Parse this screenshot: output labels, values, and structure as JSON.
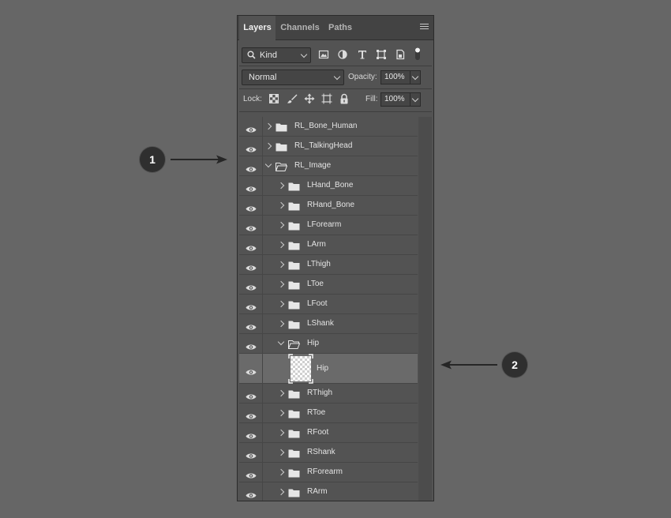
{
  "tabs": [
    {
      "label": "Layers",
      "active": true
    },
    {
      "label": "Channels",
      "active": false
    },
    {
      "label": "Paths",
      "active": false
    }
  ],
  "panel_menu_icon": "hamburger-menu-icon",
  "filter": {
    "kind_label": "Kind",
    "icons": [
      "image-filter-icon",
      "adjustment-filter-icon",
      "type-filter-icon",
      "shape-filter-icon",
      "smart-object-filter-icon",
      "filter-toggle-icon"
    ]
  },
  "blend": {
    "mode": "Normal",
    "opacity_label": "Opacity:",
    "opacity_value": "100%"
  },
  "lock": {
    "label": "Lock:",
    "icons": [
      "lock-transparent-pixels-icon",
      "lock-image-pixels-icon",
      "lock-position-icon",
      "lock-artboard-icon",
      "lock-all-icon"
    ],
    "fill_label": "Fill:",
    "fill_value": "100%"
  },
  "layers": [
    {
      "name": "RL_Bone_Human",
      "level": 0,
      "type": "group",
      "expanded": false
    },
    {
      "name": "RL_TalkingHead",
      "level": 0,
      "type": "group",
      "expanded": false
    },
    {
      "name": "RL_Image",
      "level": 0,
      "type": "group",
      "expanded": true
    },
    {
      "name": "LHand_Bone",
      "level": 1,
      "type": "group",
      "expanded": false
    },
    {
      "name": "RHand_Bone",
      "level": 1,
      "type": "group",
      "expanded": false
    },
    {
      "name": "LForearm",
      "level": 1,
      "type": "group",
      "expanded": false
    },
    {
      "name": "LArm",
      "level": 1,
      "type": "group",
      "expanded": false
    },
    {
      "name": "LThigh",
      "level": 1,
      "type": "group",
      "expanded": false
    },
    {
      "name": "LToe",
      "level": 1,
      "type": "group",
      "expanded": false
    },
    {
      "name": "LFoot",
      "level": 1,
      "type": "group",
      "expanded": false
    },
    {
      "name": "LShank",
      "level": 1,
      "type": "group",
      "expanded": false
    },
    {
      "name": "Hip",
      "level": 1,
      "type": "group",
      "expanded": true
    },
    {
      "name": "Hip",
      "level": 2,
      "type": "layer",
      "selected": true
    },
    {
      "name": "RThigh",
      "level": 1,
      "type": "group",
      "expanded": false
    },
    {
      "name": "RToe",
      "level": 1,
      "type": "group",
      "expanded": false
    },
    {
      "name": "RFoot",
      "level": 1,
      "type": "group",
      "expanded": false
    },
    {
      "name": "RShank",
      "level": 1,
      "type": "group",
      "expanded": false
    },
    {
      "name": "RForearm",
      "level": 1,
      "type": "group",
      "expanded": false
    },
    {
      "name": "RArm",
      "level": 1,
      "type": "group",
      "expanded": false
    }
  ],
  "callouts": [
    {
      "label": "1"
    },
    {
      "label": "2"
    }
  ]
}
